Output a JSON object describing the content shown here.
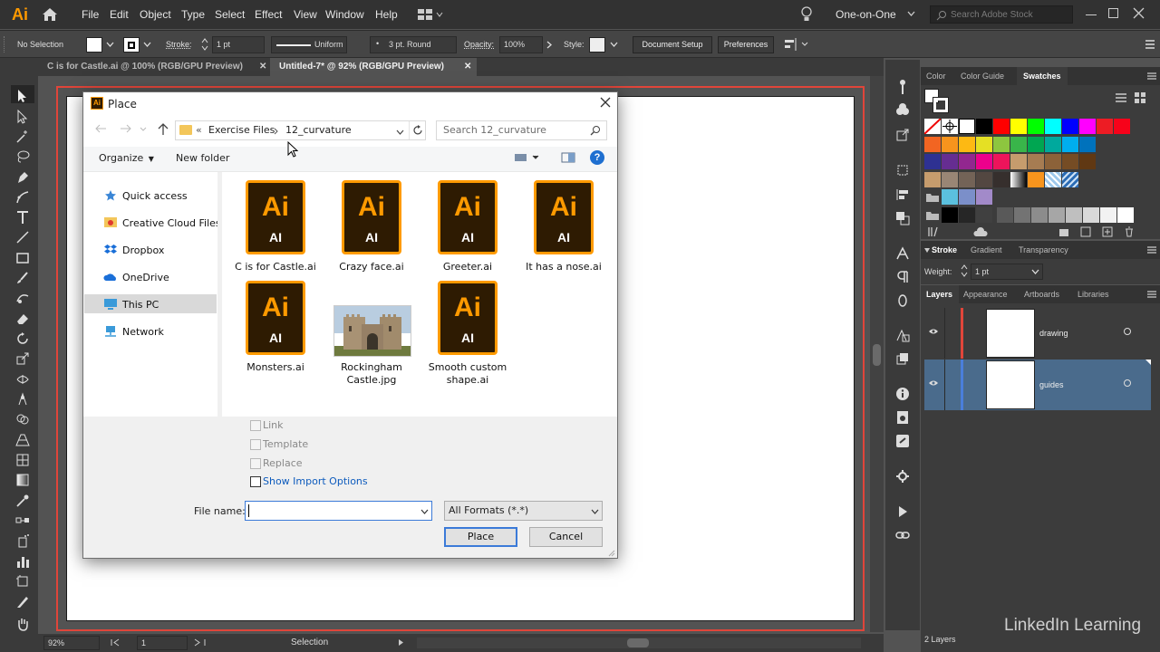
{
  "app": {
    "logo": "Ai"
  },
  "menu": [
    "File",
    "Edit",
    "Object",
    "Type",
    "Select",
    "Effect",
    "View",
    "Window",
    "Help"
  ],
  "workspace": "One-on-One",
  "search_stock": {
    "placeholder": "Search Adobe Stock"
  },
  "control": {
    "selection": "No Selection",
    "stroke_label": "Stroke:",
    "stroke_value": "1 pt",
    "profile": "Uniform",
    "brush": "3 pt. Round",
    "opacity_label": "Opacity:",
    "opacity_value": "100%",
    "style_label": "Style:",
    "doc_setup": "Document Setup",
    "preferences": "Preferences"
  },
  "tabs": [
    {
      "label": "C is for Castle.ai @ 100% (RGB/GPU Preview)",
      "active": false
    },
    {
      "label": "Untitled-7* @ 92% (RGB/GPU Preview)",
      "active": true
    }
  ],
  "status": {
    "zoom": "92%",
    "artboard": "1",
    "tool": "Selection"
  },
  "panels": {
    "color_tabs": [
      "Color",
      "Color Guide",
      "Swatches"
    ],
    "stroke_tabs": [
      "Stroke",
      "Gradient",
      "Transparency"
    ],
    "weight_label": "Weight:",
    "weight_value": "1 pt",
    "layer_tabs": [
      "Layers",
      "Appearance",
      "Artboards",
      "Libraries"
    ],
    "layers": [
      {
        "name": "drawing",
        "color": "#e0453a"
      },
      {
        "name": "guides",
        "color": "#4a7fdc"
      }
    ],
    "layer_count": "2 Layers"
  },
  "watermark": "LinkedIn Learning",
  "dialog": {
    "title": "Place",
    "breadcrumb": [
      "Exercise Files",
      "12_curvature"
    ],
    "breadcrumb_prefix": "«",
    "search_placeholder": "Search 12_curvature",
    "organize": "Organize",
    "new_folder": "New folder",
    "nav": [
      "Quick access",
      "Creative Cloud Files",
      "Dropbox",
      "OneDrive",
      "This PC",
      "Network"
    ],
    "files": [
      {
        "name": "C is for Castle.ai",
        "type": "ai"
      },
      {
        "name": "Crazy face.ai",
        "type": "ai"
      },
      {
        "name": "Greeter.ai",
        "type": "ai"
      },
      {
        "name": "It has a nose.ai",
        "type": "ai"
      },
      {
        "name": "Monsters.ai",
        "type": "ai"
      },
      {
        "name": "Rockingham Castle.jpg",
        "type": "jpg"
      },
      {
        "name": "Smooth custom shape.ai",
        "type": "ai"
      }
    ],
    "ai_big": "Ai",
    "ai_small": "AI",
    "options": [
      "Link",
      "Template",
      "Replace",
      "Show Import Options"
    ],
    "file_name_label": "File name:",
    "file_name_value": "",
    "format": "All Formats (*.*)",
    "place_button": "Place",
    "cancel_button": "Cancel"
  },
  "colors": {
    "accent": "#ff9a00",
    "bleed": "#e0453a",
    "selected_layer": "#4a6b8c",
    "dialog_link": "#0d5bbd"
  }
}
